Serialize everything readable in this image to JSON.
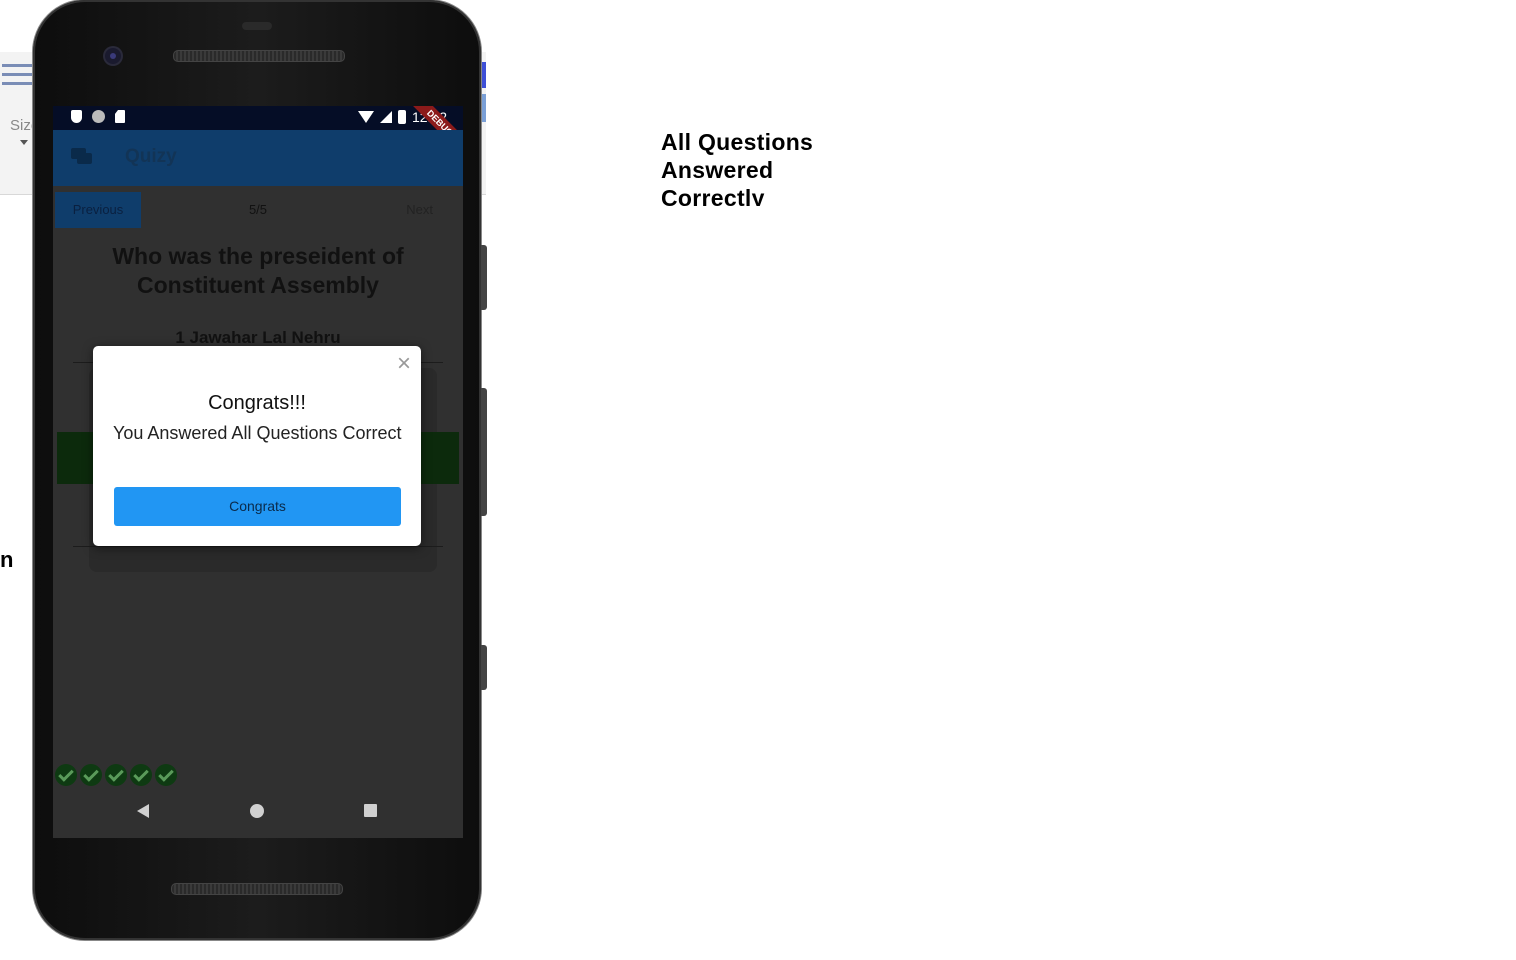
{
  "background": {
    "size_label": "Size",
    "partial_text": "n"
  },
  "status_bar": {
    "time": "12:02",
    "debug_ribbon": "DEBUG"
  },
  "app_bar": {
    "title": "Quizy",
    "icon": "chat-icon"
  },
  "quiz": {
    "previous_label": "Previous",
    "counter": "5/5",
    "next_label": "Next",
    "question": "Who was the preseident of Constituent Assembly",
    "option_1": "1 Jawahar Lal Nehru",
    "answered_count": 5
  },
  "dialog": {
    "title": "Congrats!!!",
    "message": "You Answered All Questions Correct",
    "button_label": "Congrats",
    "close_icon": "close-icon"
  },
  "caption": {
    "text": "All Questions Answered Correctly"
  },
  "colors": {
    "dialog_button": "#2196f3",
    "app_bar": "#0f3d6b",
    "screen_bg": "#303030",
    "check": "#0e3a12"
  }
}
